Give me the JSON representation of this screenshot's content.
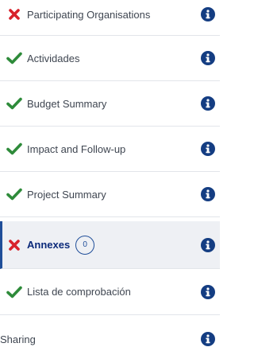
{
  "menu": {
    "items": [
      {
        "label": "Participating Organisations",
        "status": "error"
      },
      {
        "label": "Actividades",
        "status": "ok"
      },
      {
        "label": "Budget Summary",
        "status": "ok"
      },
      {
        "label": "Impact and Follow-up",
        "status": "ok"
      },
      {
        "label": "Project Summary",
        "status": "ok"
      },
      {
        "label": "Annexes",
        "status": "error",
        "count": "0",
        "active": true
      },
      {
        "label": "Lista de comprobación",
        "status": "ok"
      },
      {
        "label": "Sharing",
        "status": "none"
      }
    ]
  },
  "icons": {
    "ok": "checkmark-icon",
    "error": "cross-icon",
    "info": "info-icon"
  },
  "colors": {
    "ok": "#2e8b3a",
    "error": "#d8222b",
    "info": "#143d82",
    "active_text": "#0b2a7a",
    "active_border": "#1f4e99"
  }
}
